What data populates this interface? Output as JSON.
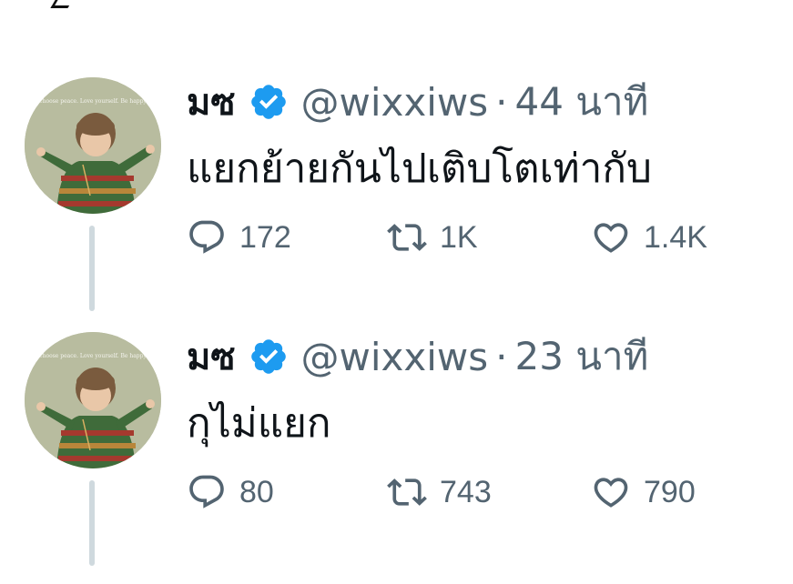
{
  "tweets": [
    {
      "display_name": "มซ",
      "handle": "@wixxiws",
      "separator": "·",
      "time": "44 นาที",
      "text": "แยกย้ายกันไปเติบโตเท่ากับ",
      "replies": "172",
      "retweets": "1K",
      "likes": "1.4K",
      "avatar_caption": "Choose peace. Love yourself. Be happy."
    },
    {
      "display_name": "มซ",
      "handle": "@wixxiws",
      "separator": "·",
      "time": "23 นาที",
      "text": "กุไม่แยก",
      "replies": "80",
      "retweets": "743",
      "likes": "790",
      "avatar_caption": "Choose peace. Love yourself. Be happy."
    }
  ],
  "colors": {
    "verified": "#1d9bf0",
    "secondary_text": "#536471",
    "thread_line": "#cfd9de"
  }
}
